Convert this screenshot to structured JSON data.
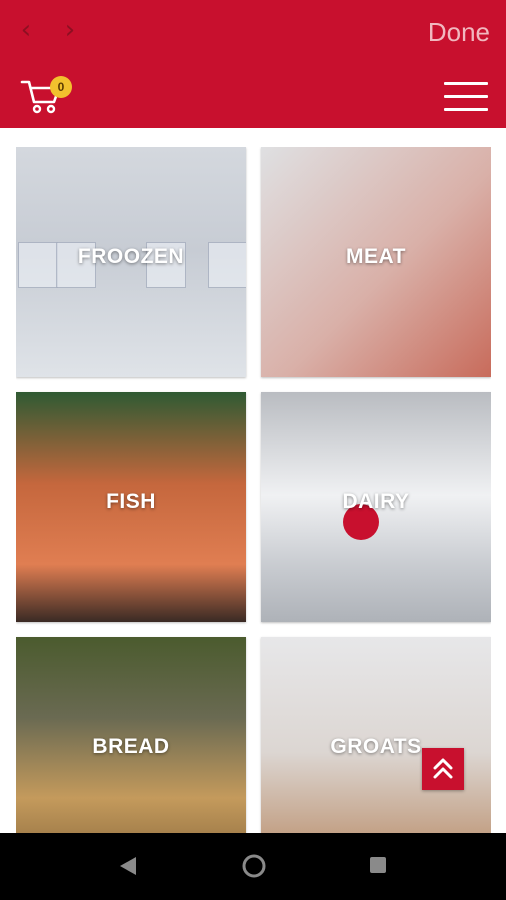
{
  "topbar": {
    "done_label": "Done",
    "back_icon": "chevron-left-icon",
    "forward_icon": "chevron-right-icon"
  },
  "appbar": {
    "cart_icon": "cart-icon",
    "cart_count": "0",
    "menu_icon": "hamburger-menu-icon"
  },
  "categories": [
    {
      "label": "FROOZEN"
    },
    {
      "label": "MEAT"
    },
    {
      "label": "FISH"
    },
    {
      "label": "DAIRY"
    },
    {
      "label": "BREAD"
    },
    {
      "label": "GROATS"
    }
  ],
  "scroll_top_icon": "double-chevron-up-icon",
  "colors": {
    "brand_red": "#c8102e",
    "badge_yellow": "#f2c12e"
  }
}
